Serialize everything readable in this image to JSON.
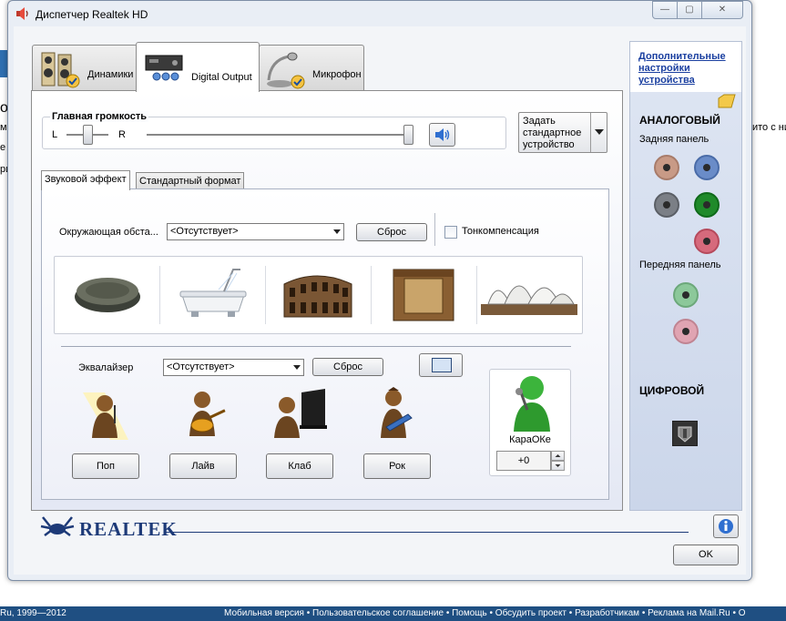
{
  "window": {
    "title": "Диспетчер Realtek HD",
    "controls": {
      "minimize": "—",
      "maximize": "▢",
      "close": "✕"
    }
  },
  "tabs": [
    {
      "label": "Динамики",
      "icon": "speakers-icon",
      "active": false
    },
    {
      "label": "Digital Output",
      "icon": "digital-output-icon",
      "active": true
    },
    {
      "label": "Микрофон",
      "icon": "microphone-icon",
      "active": false
    }
  ],
  "volume": {
    "title": "Главная громкость",
    "left_label": "L",
    "right_label": "R",
    "balance_fraction": 0.5,
    "volume_fraction": 1.0,
    "set_default_label": "Задать стандартное устройство"
  },
  "subtabs": [
    {
      "label": "Звуковой эффект",
      "active": true
    },
    {
      "label": "Стандартный формат",
      "active": false
    }
  ],
  "environment": {
    "label": "Окружающая обста...",
    "selected": "<Отсутствует>",
    "reset_label": "Сброс",
    "loudness_label": "Тонкомпенсация",
    "loudness_checked": false,
    "presets": [
      "stone-disc",
      "bathtub",
      "colosseum",
      "stone-room",
      "opera-house"
    ]
  },
  "equalizer": {
    "label": "Эквалайзер",
    "selected": "<Отсутствует>",
    "reset_label": "Сброс",
    "presets": [
      {
        "label": "Поп",
        "icon": "pop-singer-icon"
      },
      {
        "label": "Лайв",
        "icon": "live-guitarist-icon"
      },
      {
        "label": "Клаб",
        "icon": "club-pianist-icon"
      },
      {
        "label": "Рок",
        "icon": "rock-guitarist-icon"
      }
    ]
  },
  "karaoke": {
    "label": "КараОКе",
    "value": "+0"
  },
  "side_panel": {
    "link": "Дополнительные настройки устройства",
    "analog_title": "АНАЛОГОВЫЙ",
    "rear_label": "Задняя панель",
    "front_label": "Передняя панель",
    "digital_title": "ЦИФРОВОЙ",
    "rear_jacks": [
      "#c89a86",
      "#6a8cc8",
      "#7b7f86",
      "#1f8a2a",
      "#d66a7c"
    ],
    "front_jacks": [
      "#8cc89a",
      "#e0a4b2"
    ]
  },
  "footer": {
    "brand": "REALTEK",
    "ok_label": "OK"
  },
  "background": {
    "left_letters": [
      "о",
      "м",
      "е",
      "ри"
    ],
    "right_text": "ито с ни",
    "footer_copy": "Ru, 1999—2012",
    "footer_links": "Мобильная версия • Пользовательское соглашение • Помощь • Обсудить проект • Разработчикам • Реклама на Mail.Ru • О"
  }
}
